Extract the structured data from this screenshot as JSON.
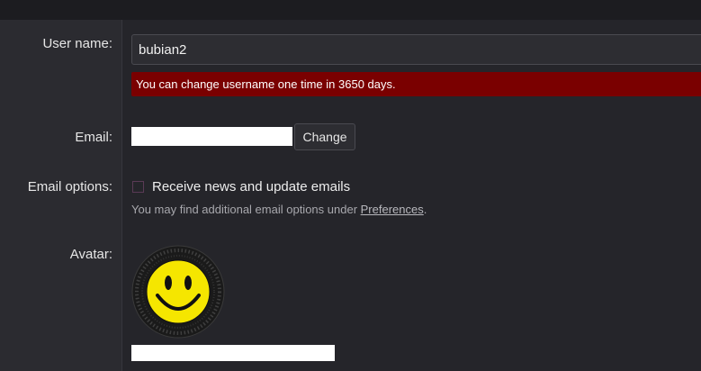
{
  "form": {
    "username_label": "User name:",
    "username_value": "bubian2",
    "username_error": "You can change username one time in 3650 days.",
    "email_label": "Email:",
    "email_value": "",
    "change_button": "Change",
    "email_options_label": "Email options:",
    "news_checkbox_label": "Receive news and update emails",
    "news_checked": false,
    "hint_prefix": "You may find additional email options under ",
    "hint_link": "Preferences",
    "hint_suffix": ".",
    "avatar_label": "Avatar:"
  },
  "colors": {
    "background": "#25252a",
    "label_column": "#2b2b30",
    "error": "#7a0000",
    "avatar_face": "#f5e600"
  },
  "icons": {
    "avatar": "smiley-face-icon"
  }
}
